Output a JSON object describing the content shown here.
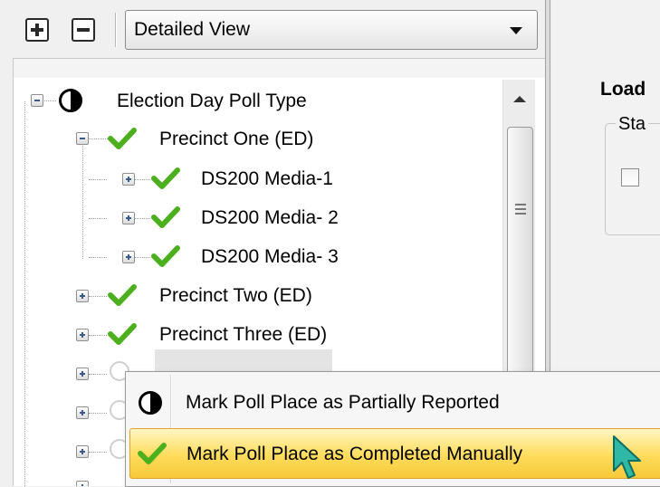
{
  "toolbar": {
    "expand_all_icon": "plus-box-icon",
    "collapse_all_icon": "minus-box-icon",
    "view_selector": {
      "value": "Detailed View"
    }
  },
  "tree": {
    "root": {
      "label": "Election Day Poll Type",
      "status_icon": "half-filled-circle-icon"
    },
    "nodes": [
      {
        "label": "Precinct One (ED)",
        "status_icon": "checkmark-icon",
        "expanded": true
      },
      {
        "label": "DS200  Media-1",
        "status_icon": "checkmark-icon"
      },
      {
        "label": "DS200  Media- 2",
        "status_icon": "checkmark-icon"
      },
      {
        "label": "DS200  Media- 3",
        "status_icon": "checkmark-icon"
      },
      {
        "label": "Precinct Two (ED)",
        "status_icon": "checkmark-icon"
      },
      {
        "label": "Precinct Three (ED)",
        "status_icon": "checkmark-icon"
      }
    ]
  },
  "right_panel": {
    "title": "Load",
    "group_label": "Sta"
  },
  "context_menu": {
    "items": [
      {
        "label": "Mark Poll Place as Partially Reported",
        "icon": "half-filled-circle-icon"
      },
      {
        "label": "Mark Poll Place as Completed Manually",
        "icon": "checkmark-icon",
        "highlighted": true
      }
    ]
  },
  "colors": {
    "check_green": "#4caf1e",
    "menu_highlight": "#ffdc5a",
    "menu_highlight_border": "#e0a42c",
    "cursor_teal": "#2fb8a6"
  }
}
